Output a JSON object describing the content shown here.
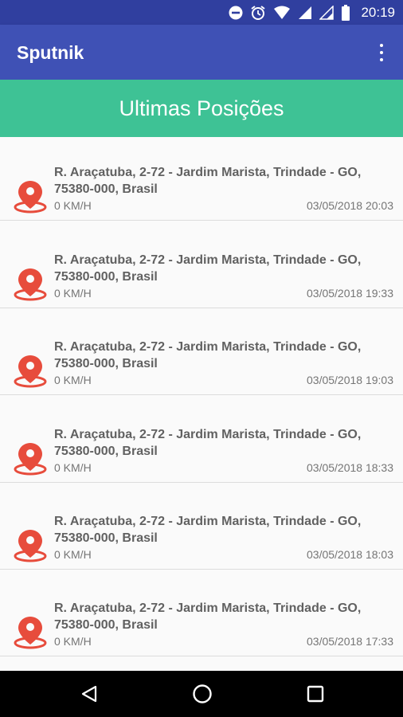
{
  "status_bar": {
    "time": "20:19",
    "icons": [
      "do-not-disturb-icon",
      "alarm-icon",
      "wifi-icon",
      "signal-icon",
      "signal-icon",
      "battery-icon"
    ]
  },
  "app_bar": {
    "title": "Sputnik",
    "menu_icon": "more-vert-icon"
  },
  "banner": {
    "title": "Ultimas Posições"
  },
  "positions": [
    {
      "address": "R. Araçatuba, 2-72 - Jardim Marista, Trindade - GO, 75380-000, Brasil",
      "speed": "0 KM/H",
      "datetime": "03/05/2018 20:03"
    },
    {
      "address": "R. Araçatuba, 2-72 - Jardim Marista, Trindade - GO, 75380-000, Brasil",
      "speed": "0 KM/H",
      "datetime": "03/05/2018 19:33"
    },
    {
      "address": "R. Araçatuba, 2-72 - Jardim Marista, Trindade - GO, 75380-000, Brasil",
      "speed": "0 KM/H",
      "datetime": "03/05/2018 19:03"
    },
    {
      "address": "R. Araçatuba, 2-72 - Jardim Marista, Trindade - GO, 75380-000, Brasil",
      "speed": "0 KM/H",
      "datetime": "03/05/2018 18:33"
    },
    {
      "address": "R. Araçatuba, 2-72 - Jardim Marista, Trindade - GO, 75380-000, Brasil",
      "speed": "0 KM/H",
      "datetime": "03/05/2018 18:03"
    },
    {
      "address": "R. Araçatuba, 2-72 - Jardim Marista, Trindade - GO, 75380-000, Brasil",
      "speed": "0 KM/H",
      "datetime": "03/05/2018 17:33"
    }
  ],
  "colors": {
    "primary": "#3f51b5",
    "primary_dark": "#303f9f",
    "accent_banner": "#3ec295",
    "pin": "#e74c3c"
  },
  "nav_bar": {
    "icons": [
      "back-icon",
      "home-icon",
      "recents-icon"
    ]
  }
}
